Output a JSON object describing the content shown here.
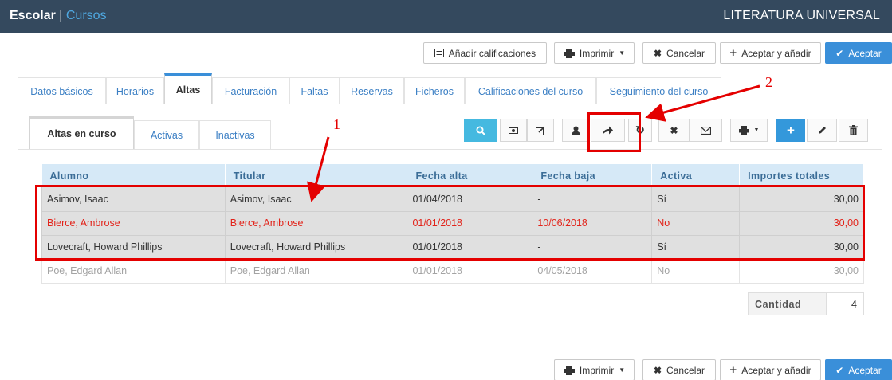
{
  "app": {
    "module": "Escolar",
    "separator": "|",
    "section": "Cursos",
    "course_name": "LITERATURA UNIVERSAL"
  },
  "actions": {
    "add_grades": "Añadir calificaciones",
    "print": "Imprimir",
    "cancel": "Cancelar",
    "accept_add": "Aceptar y añadir",
    "accept": "Aceptar"
  },
  "tabs": [
    "Datos básicos",
    "Horarios",
    "Altas",
    "Facturación",
    "Faltas",
    "Reservas",
    "Ficheros",
    "Calificaciones del curso",
    "Seguimiento del curso"
  ],
  "active_tab": "Altas",
  "subtabs": [
    "Altas en curso",
    "Activas",
    "Inactivas"
  ],
  "active_subtab": "Altas en curso",
  "toolbar_icons": [
    "search-icon",
    "camera-icon",
    "edit-note-icon",
    "user-icon",
    "share-arrow-icon",
    "refresh-icon",
    "close-icon",
    "mail-icon",
    "print-icon",
    "add-icon",
    "pencil-icon",
    "trash-icon"
  ],
  "table": {
    "columns": [
      "Alumno",
      "Titular",
      "Fecha alta",
      "Fecha baja",
      "Activa",
      "Importes totales"
    ],
    "rows": [
      {
        "alumno": "Asimov, Isaac",
        "titular": "Asimov, Isaac",
        "fecha_alta": "01/04/2018",
        "fecha_baja": "-",
        "activa": "Sí",
        "importe": "30,00"
      },
      {
        "alumno": "Bierce, Ambrose",
        "titular": "Bierce, Ambrose",
        "fecha_alta": "01/01/2018",
        "fecha_baja": "10/06/2018",
        "activa": "No",
        "importe": "30,00"
      },
      {
        "alumno": "Lovecraft, Howard Phillips",
        "titular": "Lovecraft, Howard Phillips",
        "fecha_alta": "01/01/2018",
        "fecha_baja": "-",
        "activa": "Sí",
        "importe": "30,00"
      },
      {
        "alumno": "Poe, Edgard Allan",
        "titular": "Poe, Edgard Allan",
        "fecha_alta": "01/01/2018",
        "fecha_baja": "04/05/2018",
        "activa": "No",
        "importe": "30,00"
      }
    ]
  },
  "quantity": {
    "label": "Cantidad",
    "value": "4"
  },
  "annotations": {
    "one": "1",
    "two": "2"
  },
  "colors": {
    "header": "#34495e",
    "accent": "#3a8fd9",
    "annotation": "#e40000",
    "inactive_row": "#e2231a"
  }
}
